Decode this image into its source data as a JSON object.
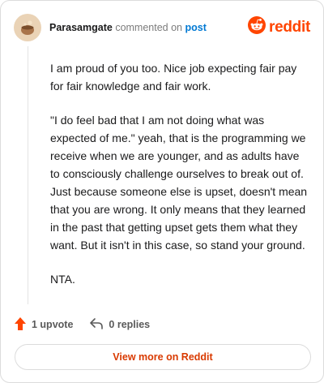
{
  "header": {
    "username": "Parasamgate",
    "verb": "commented on",
    "target": "post",
    "brand": "reddit"
  },
  "comment": {
    "paragraphs": [
      "I am proud of you too. Nice job expecting fair pay for fair knowledge and fair work.",
      "\"I do feel bad that I am not doing what was expected of me.\" yeah, that is the programming we receive when we are younger, and as adults have to consciously challenge ourselves to break out of. Just because someone else is upset, doesn't mean that you are wrong. It only means that they learned in the past that getting upset gets them what they want. But it isn't in this case, so stand your ground.",
      "NTA."
    ]
  },
  "actions": {
    "upvote_label": "1 upvote",
    "replies_label": "0 replies"
  },
  "footer": {
    "view_more_label": "View more on Reddit"
  },
  "colors": {
    "brand": "#ff4500",
    "link": "#0079d3",
    "view_more": "#d93a00"
  },
  "icons": {
    "avatar": "avatar-icon",
    "logo": "reddit-logo-icon",
    "upvote": "upvote-arrow-icon",
    "reply": "reply-arrow-icon"
  }
}
